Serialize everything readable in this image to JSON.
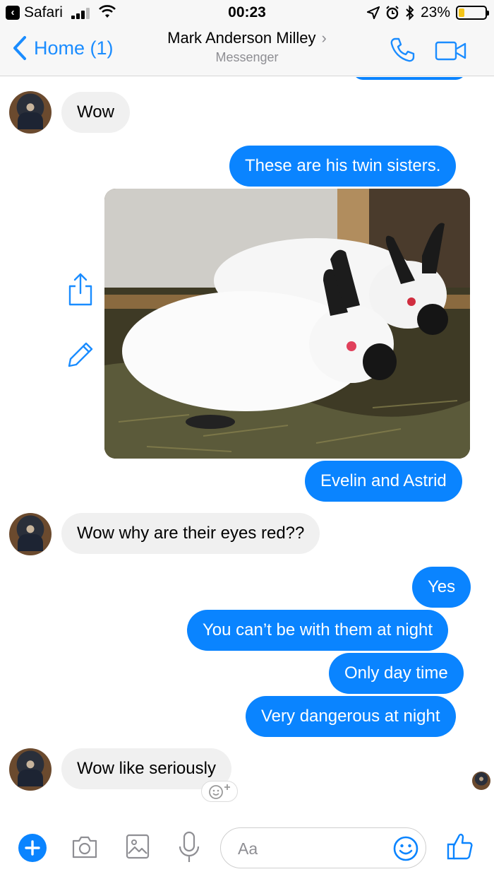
{
  "status_bar": {
    "back_app": "Safari",
    "time": "00:23",
    "battery_percent": "23%",
    "battery_level": 0.23,
    "battery_color": "#f5c518"
  },
  "header": {
    "back_label": "Home (1)",
    "contact_name": "Mark Anderson Milley",
    "subtitle": "Messenger",
    "icons": [
      "chevron-left-icon",
      "phone-icon",
      "video-camera-icon"
    ]
  },
  "messages": [
    {
      "from": "them",
      "text": "Wow"
    },
    {
      "from": "me",
      "text": "These are his twin sisters."
    },
    {
      "from": "me",
      "type": "photo",
      "description_icon": "rabbits-photo"
    },
    {
      "from": "me",
      "text": "Evelin and Astrid"
    },
    {
      "from": "them",
      "text": "Wow why are their eyes red??"
    },
    {
      "from": "me",
      "text": "Yes"
    },
    {
      "from": "me",
      "text": "You can’t be with them at night"
    },
    {
      "from": "me",
      "text": "Only day time"
    },
    {
      "from": "me",
      "text": "Very dangerous at night"
    },
    {
      "from": "them",
      "text": "Wow like seriously"
    }
  ],
  "composer": {
    "placeholder": "Aa",
    "icons": [
      "plus-icon",
      "camera-icon",
      "gallery-icon",
      "microphone-icon",
      "emoji-icon",
      "thumbs-up-icon"
    ]
  },
  "colors": {
    "accent": "#0a84ff",
    "incoming_bubble": "#f0f0f0"
  }
}
